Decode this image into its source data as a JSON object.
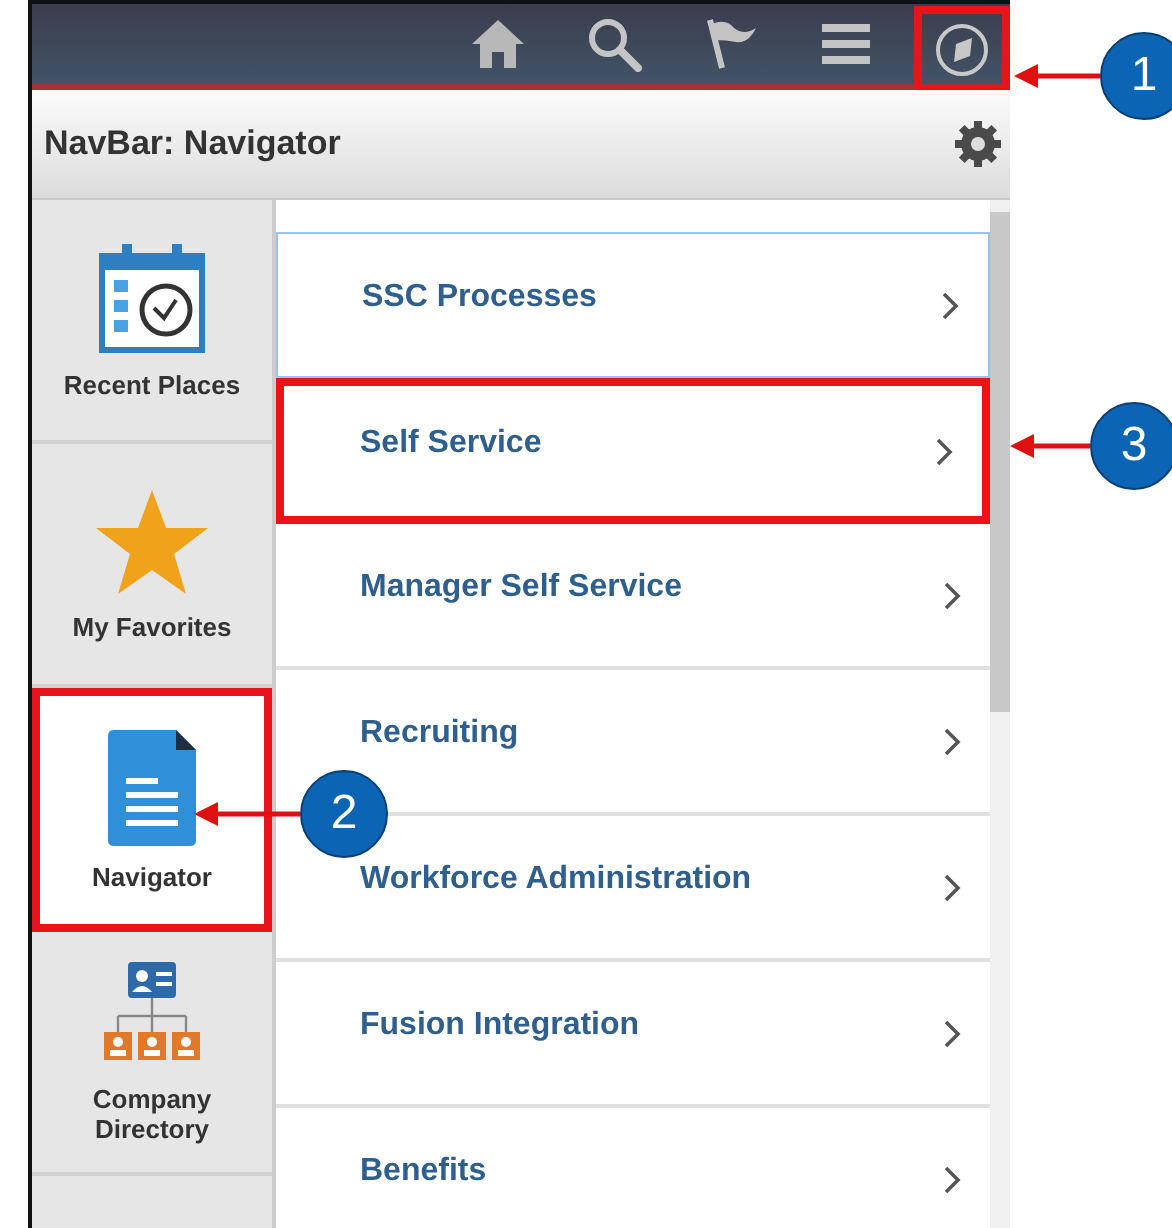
{
  "navbar": {
    "icons": [
      {
        "kind": "home",
        "highlighted": false
      },
      {
        "kind": "search",
        "highlighted": false
      },
      {
        "kind": "flag",
        "highlighted": false
      },
      {
        "kind": "menu",
        "highlighted": false
      },
      {
        "kind": "compass",
        "highlighted": true
      }
    ]
  },
  "header": {
    "title": "NavBar: Navigator"
  },
  "sidebar": {
    "items": [
      {
        "label": "Recent Places",
        "kind": "calendar",
        "selected": false,
        "highlighted": false
      },
      {
        "label": "My Favorites",
        "kind": "star",
        "selected": false,
        "highlighted": false
      },
      {
        "label": "Navigator",
        "kind": "document",
        "selected": true,
        "highlighted": true
      },
      {
        "label": "Company Directory",
        "kind": "directory",
        "selected": false,
        "highlighted": false
      }
    ]
  },
  "menu": {
    "items": [
      {
        "label": "SSC Processes",
        "focused": true,
        "highlighted": false
      },
      {
        "label": "Self Service",
        "focused": false,
        "highlighted": true
      },
      {
        "label": "Manager Self Service",
        "focused": false,
        "highlighted": false
      },
      {
        "label": "Recruiting",
        "focused": false,
        "highlighted": false
      },
      {
        "label": "Workforce Administration",
        "focused": false,
        "highlighted": false
      },
      {
        "label": "Fusion Integration",
        "focused": false,
        "highlighted": false
      },
      {
        "label": "Benefits",
        "focused": false,
        "highlighted": false
      }
    ]
  },
  "callouts": [
    {
      "number": "1"
    },
    {
      "number": "2"
    },
    {
      "number": "3"
    }
  ]
}
